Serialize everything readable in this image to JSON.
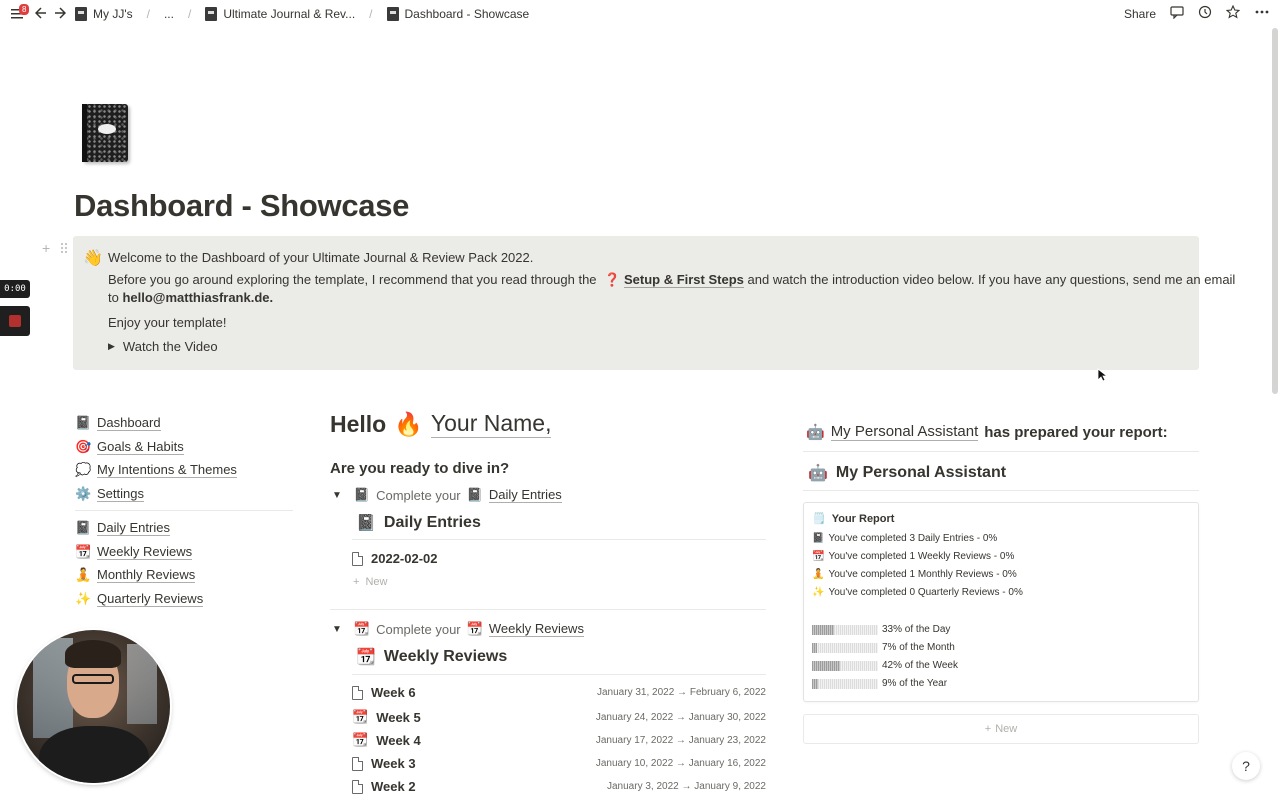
{
  "topbar": {
    "notification_count": "8",
    "breadcrumbs": [
      "My JJ's",
      "...",
      "Ultimate Journal & Rev...",
      "Dashboard - Showcase"
    ],
    "share_label": "Share"
  },
  "page": {
    "title": "Dashboard - Showcase"
  },
  "callout": {
    "line1": "Welcome to the Dashboard of your Ultimate Journal & Review Pack 2022.",
    "line2_pre": "Before you go around exploring the template, I recommend that you read through the",
    "line2_link": "Setup & First Steps",
    "line2_post": "and watch the introduction video below. If you have any questions, send me an email",
    "line3_pre": "to",
    "line3_email": "hello@matthiasfrank.de.",
    "line4": "Enjoy your template!",
    "toggle_label": "Watch the Video"
  },
  "sidebar": {
    "group1": [
      {
        "label": "Dashboard",
        "icon": "📓"
      },
      {
        "label": "Goals & Habits",
        "icon": "🎯"
      },
      {
        "label": "My Intentions & Themes",
        "icon": "💭"
      },
      {
        "label": "Settings",
        "icon": "⚙️"
      }
    ],
    "group2": [
      {
        "label": "Daily Entries",
        "icon": "📓"
      },
      {
        "label": "Weekly Reviews",
        "icon": "📆"
      },
      {
        "label": "Monthly Reviews",
        "icon": "🧘"
      },
      {
        "label": "Quarterly Reviews",
        "icon": "✨"
      }
    ]
  },
  "middle": {
    "hello": "Hello",
    "name": "Your Name,",
    "question": "Are you ready to dive in?",
    "toggle_prefix": "Complete your",
    "daily": {
      "link": "Daily Entries",
      "db_title": "Daily Entries",
      "entries": [
        "2022-02-02"
      ],
      "new_label": "New"
    },
    "weekly": {
      "link": "Weekly Reviews",
      "db_title": "Weekly Reviews",
      "entries": [
        {
          "title": "Week 6",
          "dates": "January 31, 2022 → February 6, 2022",
          "icon": "doc"
        },
        {
          "title": "Week 5",
          "dates": "January 24, 2022 → January 30, 2022",
          "icon": "calendar"
        },
        {
          "title": "Week 4",
          "dates": "January 17, 2022 → January 23, 2022",
          "icon": "calendar"
        },
        {
          "title": "Week 3",
          "dates": "January 10, 2022 → January 16, 2022",
          "icon": "doc"
        },
        {
          "title": "Week 2",
          "dates": "January 3, 2022 → January 9, 2022",
          "icon": "doc"
        }
      ]
    }
  },
  "right": {
    "report_heading_link": "My Personal Assistant",
    "report_heading_rest": "has prepared your report:",
    "assistant_title": "My Personal Assistant",
    "report_title": "Your Report",
    "report_lines": [
      {
        "icon": "📓",
        "text": "You've completed 3 Daily Entries - 0%"
      },
      {
        "icon": "📆",
        "text": "You've completed 1 Weekly Reviews - 0%"
      },
      {
        "icon": "🧘",
        "text": "You've completed 1 Monthly Reviews - 0%"
      },
      {
        "icon": "✨",
        "text": "You've completed 0 Quarterly Reviews - 0%"
      }
    ],
    "progress": [
      {
        "label": "33% of the Day",
        "value": 0.33
      },
      {
        "label": "7% of the Month",
        "value": 0.07
      },
      {
        "label": "42% of the Week",
        "value": 0.42
      },
      {
        "label": "9% of the Year",
        "value": 0.09
      }
    ],
    "new_label": "New"
  },
  "recorder": {
    "time": "0:00"
  },
  "help_label": "?"
}
